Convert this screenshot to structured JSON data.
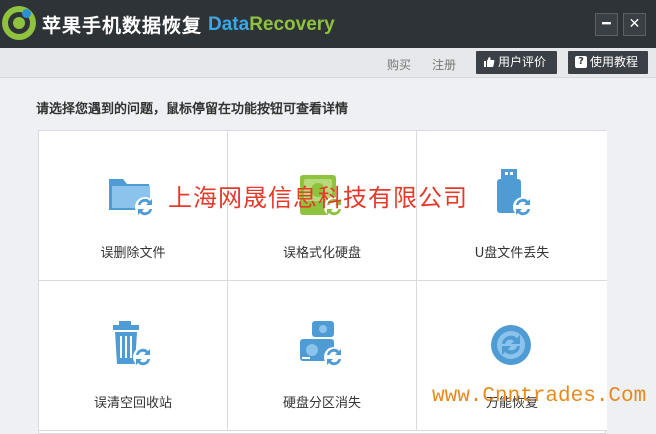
{
  "app": {
    "title": "苹果手机数据恢复",
    "brand_part1": "Data",
    "brand_part2": "Recovery",
    "minimize_icon": "minimize-icon",
    "close_icon": "close-icon"
  },
  "nav": {
    "buy": "购买",
    "register": "注册",
    "review": "用户评价",
    "tutorial": "使用教程"
  },
  "instruction": "请选择您遇到的问题，鼠标停留在功能按钮可查看详情",
  "options": [
    {
      "label": "误删除文件",
      "icon": "folder-recover-icon"
    },
    {
      "label": "误格式化硬盘",
      "icon": "format-disk-icon"
    },
    {
      "label": "U盘文件丢失",
      "icon": "usb-drive-icon"
    },
    {
      "label": "误清空回收站",
      "icon": "recycle-bin-icon"
    },
    {
      "label": "硬盘分区消失",
      "icon": "partition-icon"
    },
    {
      "label": "万能恢复",
      "icon": "universal-recover-icon"
    }
  ],
  "watermarks": {
    "company": "上海网晟信息科技有限公司",
    "url": "www.Cnntrades.Com"
  },
  "colors": {
    "titlebar": "#2e3338",
    "accent_blue": "#3aa7e8",
    "accent_green": "#8fc23d",
    "icon_blue": "#4f9bd3"
  }
}
